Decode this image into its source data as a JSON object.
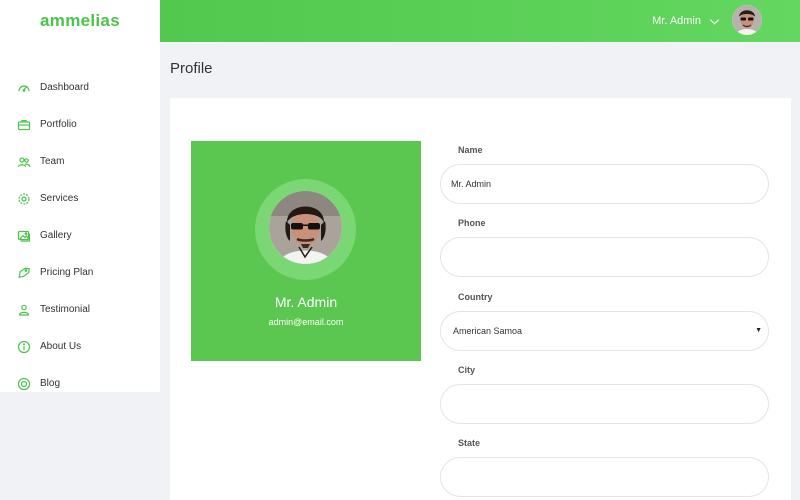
{
  "brand": "ammelias",
  "sidebar": {
    "items": [
      {
        "label": "Dashboard",
        "icon": "dashboard-gauge-icon"
      },
      {
        "label": "Portfolio",
        "icon": "briefcase-icon"
      },
      {
        "label": "Team",
        "icon": "team-icon"
      },
      {
        "label": "Services",
        "icon": "gear-icon"
      },
      {
        "label": "Gallery",
        "icon": "gallery-icon"
      },
      {
        "label": "Pricing Plan",
        "icon": "tag-icon"
      },
      {
        "label": "Testimonial",
        "icon": "user-icon"
      },
      {
        "label": "About Us",
        "icon": "info-icon"
      },
      {
        "label": "Blog",
        "icon": "blog-icon"
      }
    ]
  },
  "topbar": {
    "user_name": "Mr. Admin",
    "chevron": "chevron-down-icon"
  },
  "page": {
    "title": "Profile"
  },
  "profile_card": {
    "name": "Mr. Admin",
    "email": "admin@email.com"
  },
  "form": {
    "name_label": "Name",
    "name_value": "Mr. Admin",
    "phone_label": "Phone",
    "phone_value": "",
    "country_label": "Country",
    "country_value": "American Samoa",
    "city_label": "City",
    "city_value": "",
    "state_label": "State",
    "state_value": ""
  },
  "colors": {
    "accent": "#5bc751",
    "topbar": "#5ccf57",
    "background": "#f1f2f6"
  }
}
